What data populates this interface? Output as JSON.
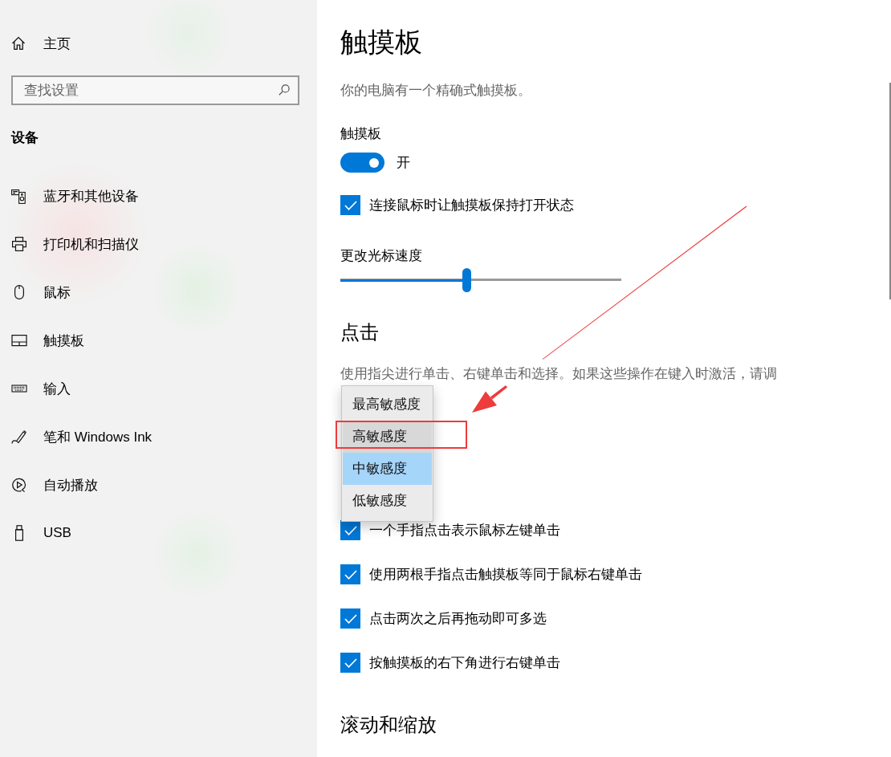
{
  "sidebar": {
    "home": {
      "label": "主页"
    },
    "search": {
      "placeholder": "查找设置"
    },
    "section_title": "设备",
    "items": [
      {
        "kind": "devices",
        "label": "蓝牙和其他设备"
      },
      {
        "kind": "printer",
        "label": "打印机和扫描仪"
      },
      {
        "kind": "mouse",
        "label": "鼠标"
      },
      {
        "kind": "touchpad",
        "label": "触摸板"
      },
      {
        "kind": "keyboard",
        "label": "输入"
      },
      {
        "kind": "pen",
        "label": "笔和 Windows Ink"
      },
      {
        "kind": "autoplay",
        "label": "自动播放"
      },
      {
        "kind": "usb",
        "label": "USB"
      }
    ]
  },
  "content": {
    "title": "触摸板",
    "description": "你的电脑有一个精确式触摸板。",
    "touchpad_switch": {
      "label": "触摸板",
      "on": true,
      "state_text": "开"
    },
    "keep_on_option": {
      "label": "连接鼠标时让触摸板保持打开状态",
      "checked": true
    },
    "cursor_speed": {
      "label": "更改光标速度",
      "level": 0.45
    },
    "taps": {
      "heading": "点击",
      "description": "使用指尖进行单击、右键单击和选择。如果这些操作在键入时激活，请调",
      "sensitivity_options": [
        {
          "label": "最高敏感度",
          "selected": false,
          "hovered": false
        },
        {
          "label": "高敏感度",
          "selected": false,
          "hovered": true
        },
        {
          "label": "中敏感度",
          "selected": true,
          "hovered": false
        },
        {
          "label": "低敏感度",
          "selected": false,
          "hovered": false
        }
      ],
      "options": [
        {
          "label": "一个手指点击表示鼠标左键单击",
          "checked": true
        },
        {
          "label": "使用两根手指点击触摸板等同于鼠标右键单击",
          "checked": true
        },
        {
          "label": "点击两次之后再拖动即可多选",
          "checked": true
        },
        {
          "label": "按触摸板的右下角进行右键单击",
          "checked": true
        }
      ]
    },
    "scroll_zoom": {
      "heading": "滚动和缩放"
    }
  }
}
